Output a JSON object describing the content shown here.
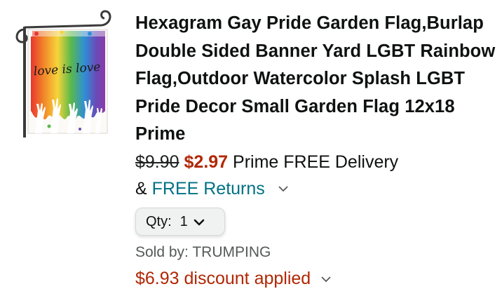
{
  "product": {
    "title": "Hexagram Gay Pride Garden Flag,Burlap Double Sided Banner Yard LGBT Rainbow Flag,Outdoor Watercolor Splash LGBT Pride Decor Small Garden Flag 12x18 Prime",
    "image_text": "love is love",
    "image_icon": "rainbow-garden-flag-image"
  },
  "price": {
    "original": "$9.90",
    "current": "$2.97",
    "delivery": "Prime FREE Delivery",
    "returns_prefix": "& ",
    "returns_link": "FREE Returns"
  },
  "quantity": {
    "label": "Qty:",
    "value": "1"
  },
  "seller": {
    "text": "Sold by: TRUMPING"
  },
  "discount": {
    "text": "$6.93 discount applied"
  },
  "colors": {
    "link": "#007185",
    "price_red": "#b12704",
    "text": "#0f1111",
    "muted": "#565959"
  }
}
